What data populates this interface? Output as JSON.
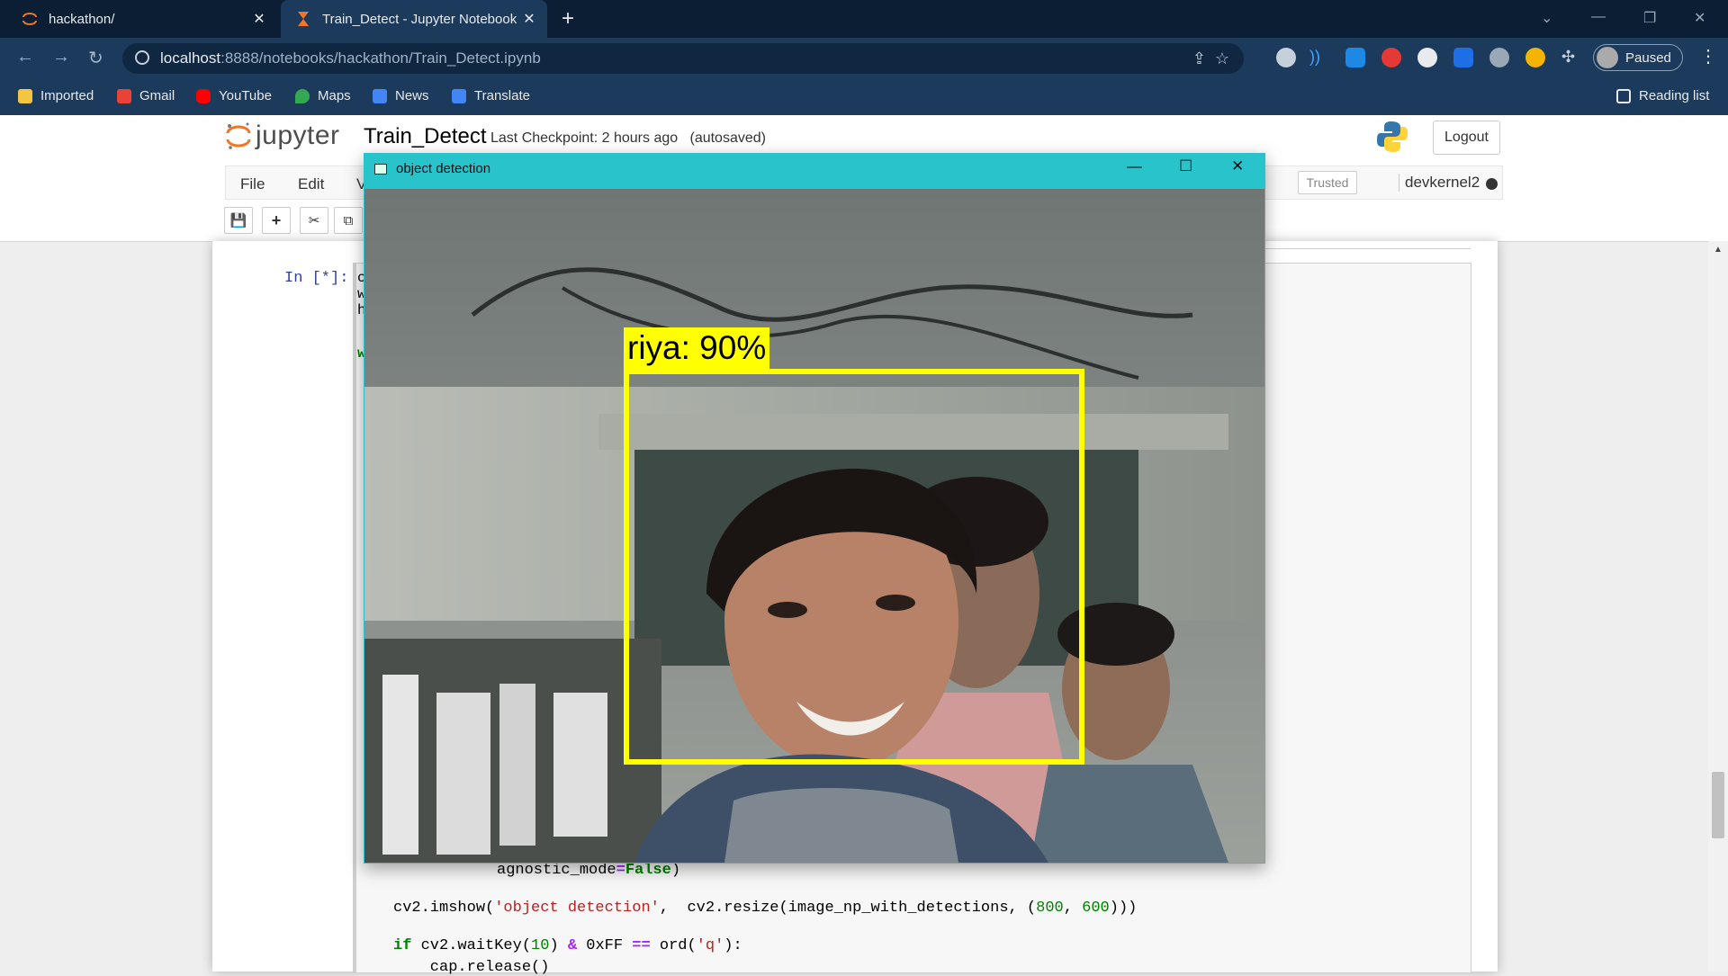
{
  "browser": {
    "tabs": [
      {
        "title": "hackathon/",
        "active": false
      },
      {
        "title": "Train_Detect - Jupyter Notebook",
        "active": true
      }
    ],
    "url_host": "localhost",
    "url_path": ":8888/notebooks/hackathon/Train_Detect.ipynb",
    "profile_label": "Paused",
    "bookmarks": [
      "Imported",
      "Gmail",
      "YouTube",
      "Maps",
      "News",
      "Translate"
    ],
    "reading_list": "Reading list"
  },
  "jupyter": {
    "logo_text": "jupyter",
    "notebook_title": "Train_Detect",
    "checkpoint": "Last Checkpoint: 2 hours ago",
    "autosave": "(autosaved)",
    "logout_label": "Logout",
    "menu": [
      "File",
      "Edit",
      "V"
    ],
    "trusted_label": "Trusted",
    "kernel_name": "devkernel2",
    "prompt": "In [*]:",
    "edge_chars": [
      "c",
      "w",
      "h",
      "w"
    ],
    "code_lines": {
      "line1_text": "agnostic_mode",
      "line1_op": "=",
      "line1_kw": "False",
      "line1_end": ")",
      "line2_a": "cv2.imshow(",
      "line2_str": "'object detection'",
      "line2_b": ",  cv2.resize(image_np_with_detections, (",
      "line2_n1": "800",
      "line2_c": ", ",
      "line2_n2": "600",
      "line2_d": ")))",
      "line3_kw": "if",
      "line3_a": " cv2.waitKey(",
      "line3_n1": "10",
      "line3_b": ") ",
      "line3_op1": "&",
      "line3_c": " 0xFF ",
      "line3_op2": "==",
      "line3_d": " ord(",
      "line3_str": "'q'",
      "line3_e": "):",
      "line4": "    cap.release()"
    }
  },
  "cv_window": {
    "title": "object detection",
    "detection_label": "riya: 90%"
  },
  "colors": {
    "tab_bg": "#0b1e33",
    "toolbar_bg": "#1b3a5c",
    "cv_titlebar": "#29c3cc",
    "bbox": "#ffff00"
  }
}
